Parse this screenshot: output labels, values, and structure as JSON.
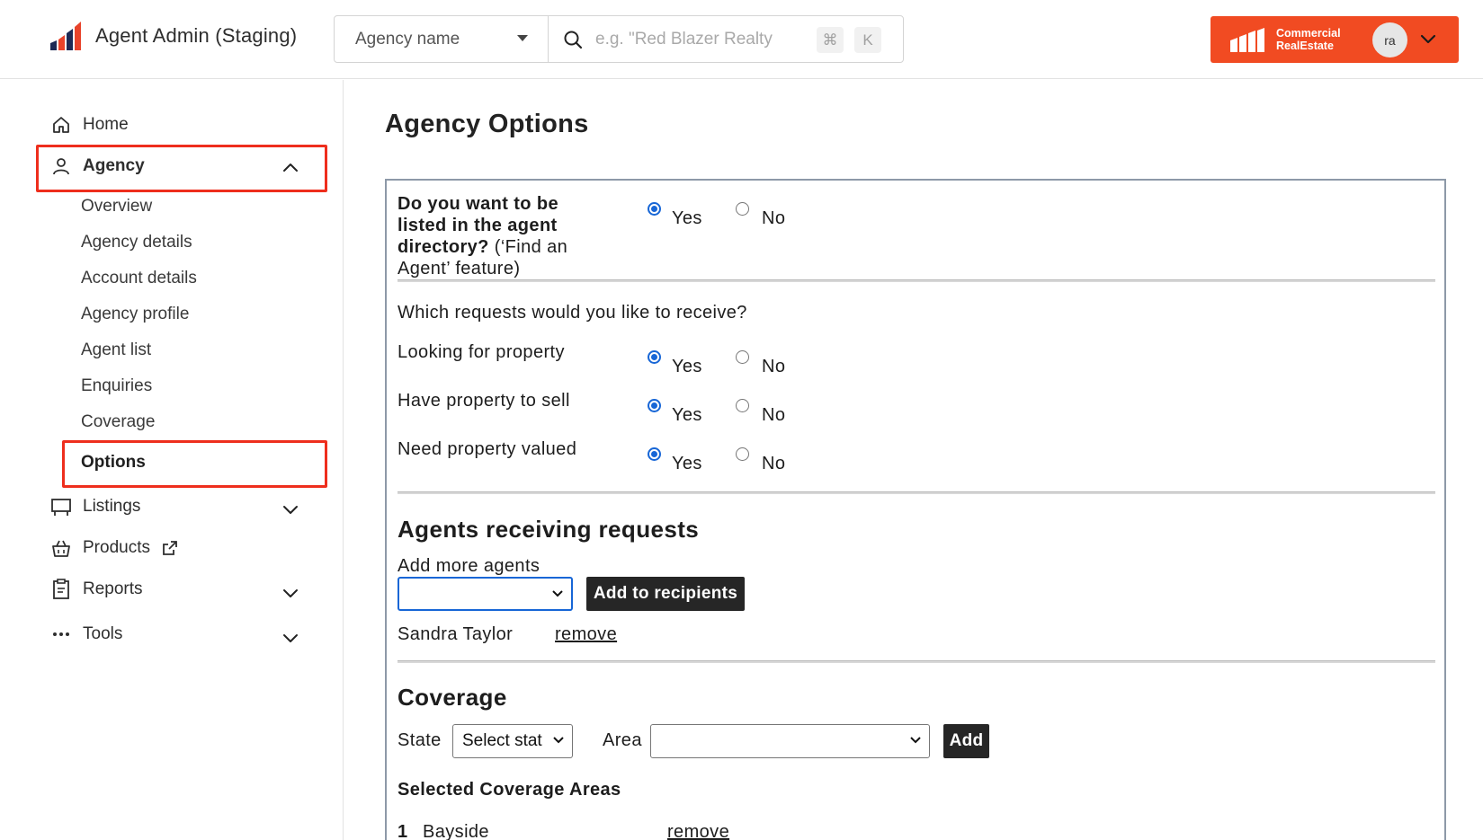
{
  "header": {
    "app_title": "Agent Admin (Staging)",
    "agency_select": {
      "value": "Agency name"
    },
    "search": {
      "placeholder": "e.g. \"Red Blazer Realty",
      "shortcut_cmd": "⌘",
      "shortcut_key": "K"
    },
    "account": {
      "brand_line1": "Commercial",
      "brand_line2": "RealEstate",
      "avatar_initials": "ra"
    },
    "accent_color": "#f14b22"
  },
  "sidebar": {
    "home": "Home",
    "agency": {
      "label": "Agency",
      "items": [
        "Overview",
        "Agency details",
        "Account details",
        "Agency profile",
        "Agent list",
        "Enquiries",
        "Coverage",
        "Options"
      ],
      "selected": "Options"
    },
    "listings": "Listings",
    "products": "Products",
    "reports": "Reports",
    "tools": "Tools",
    "highlight_color": "#ee2e1d"
  },
  "main": {
    "title": "Agency Options",
    "directory": {
      "question_bold": "Do you want to be listed in the agent directory?",
      "question_rest": " (‘Find an Agent’ feature)",
      "yes": "Yes",
      "no": "No",
      "value": "Yes"
    },
    "requests": {
      "intro": "Which requests would you like to receive?",
      "rows": [
        {
          "label": "Looking for property",
          "yes": "Yes",
          "no": "No",
          "value": "Yes"
        },
        {
          "label": "Have property to sell",
          "yes": "Yes",
          "no": "No",
          "value": "Yes"
        },
        {
          "label": "Need property valued",
          "yes": "Yes",
          "no": "No",
          "value": "Yes"
        }
      ]
    },
    "agents": {
      "heading": "Agents receiving requests",
      "add_label": "Add more agents",
      "select_value": "",
      "add_button": "Add to recipients",
      "recipients": [
        {
          "name": "Sandra Taylor",
          "action": "remove"
        }
      ]
    },
    "coverage": {
      "heading": "Coverage",
      "state_label": "State",
      "state_value": "Select stat",
      "area_label": "Area",
      "area_value": "",
      "add_button": "Add",
      "selected_heading": "Selected Coverage Areas",
      "areas": [
        {
          "index": "1",
          "name": "Bayside",
          "action": "remove"
        }
      ]
    },
    "radio_color": "#1766d6"
  }
}
